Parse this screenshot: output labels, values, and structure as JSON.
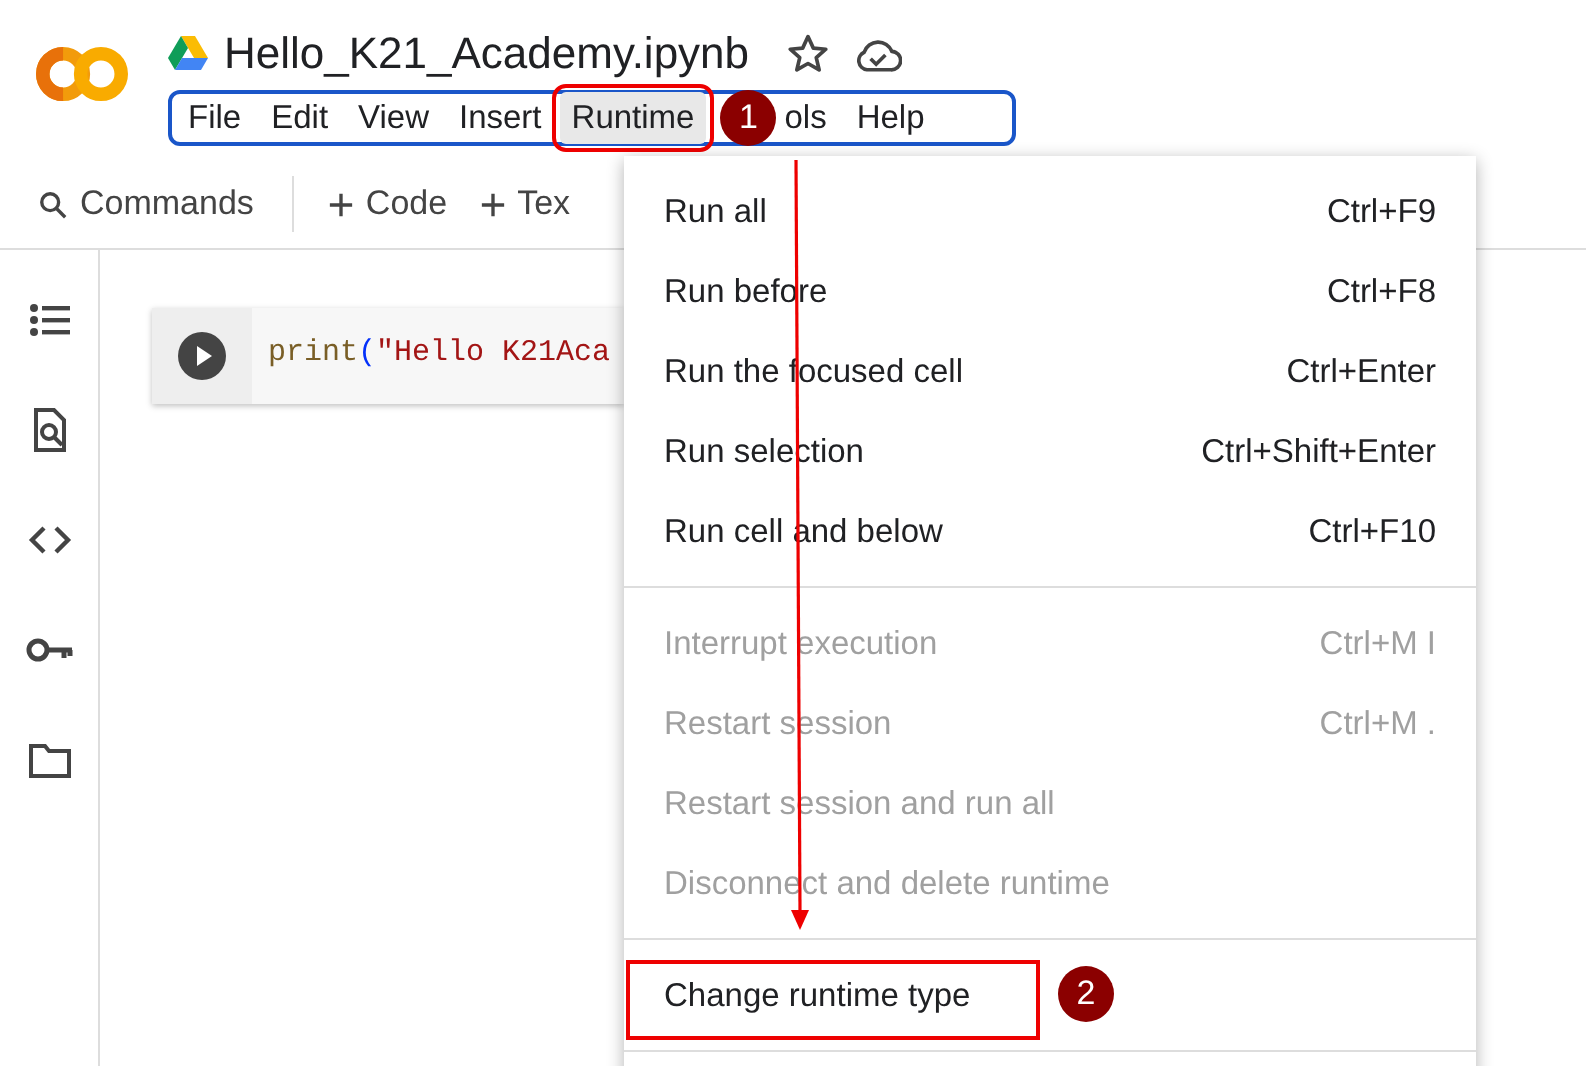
{
  "notebook": {
    "title": "Hello_K21_Academy.ipynb"
  },
  "menu_bar": [
    {
      "label": "File",
      "selected": false,
      "annotated": false
    },
    {
      "label": "Edit",
      "selected": false,
      "annotated": false
    },
    {
      "label": "View",
      "selected": false,
      "annotated": false
    },
    {
      "label": "Insert",
      "selected": false,
      "annotated": false
    },
    {
      "label": "Runtime",
      "selected": true,
      "annotated": true,
      "callout": "1"
    },
    {
      "label": "ols",
      "selected": false,
      "annotated": false
    },
    {
      "label": "Help",
      "selected": false,
      "annotated": false
    }
  ],
  "toolbar": [
    {
      "kind": "search",
      "label": "Commands"
    },
    {
      "kind": "add",
      "label": "Code"
    },
    {
      "kind": "add",
      "label": "Tex"
    }
  ],
  "cell": {
    "tokens": [
      {
        "kind": "function",
        "text": "print"
      },
      {
        "kind": "bracket",
        "text": "("
      },
      {
        "kind": "string",
        "text": "\"Hello K21Aca"
      }
    ]
  },
  "runtime_menu": {
    "sections": [
      [
        {
          "label": "Run all",
          "shortcut": "Ctrl+F9",
          "disabled": false,
          "annotated": false
        },
        {
          "label": "Run before",
          "shortcut": "Ctrl+F8",
          "disabled": false,
          "annotated": false
        },
        {
          "label": "Run the focused cell",
          "shortcut": "Ctrl+Enter",
          "disabled": false,
          "annotated": false
        },
        {
          "label": "Run selection",
          "shortcut": "Ctrl+Shift+Enter",
          "disabled": false,
          "annotated": false
        },
        {
          "label": "Run cell and below",
          "shortcut": "Ctrl+F10",
          "disabled": false,
          "annotated": false
        }
      ],
      [
        {
          "label": "Interrupt execution",
          "shortcut": "Ctrl+M I",
          "disabled": true,
          "annotated": false
        },
        {
          "label": "Restart session",
          "shortcut": "Ctrl+M .",
          "disabled": true,
          "annotated": false
        },
        {
          "label": "Restart session and run all",
          "disabled": true,
          "annotated": false
        },
        {
          "label": "Disconnect and delete runtime",
          "disabled": true,
          "annotated": false
        }
      ],
      [
        {
          "label": "Change runtime type",
          "disabled": false,
          "annotated": true,
          "callout": "2"
        }
      ]
    ]
  },
  "annotation_arrow": true
}
